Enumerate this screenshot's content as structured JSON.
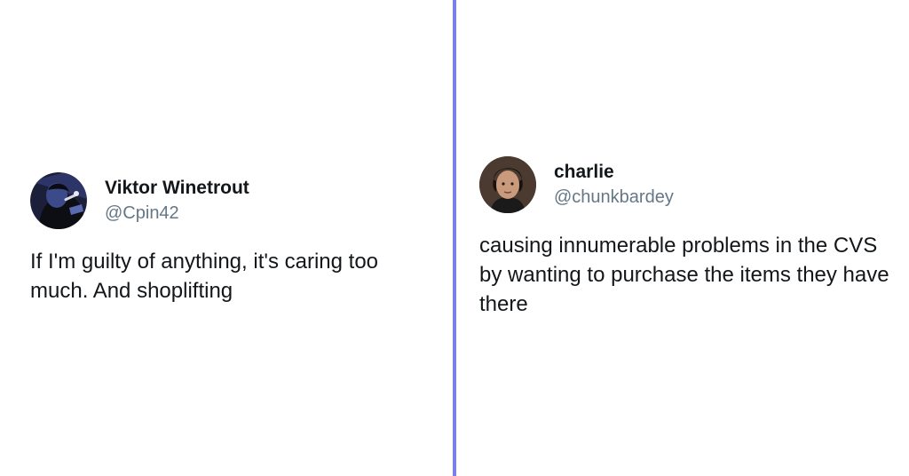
{
  "tweets": [
    {
      "display_name": "Viktor Winetrout",
      "handle": "@Cpin42",
      "text": "If I'm guilty of anything, it's caring too much. And shoplifting",
      "avatar_icon": "dark-illustrated-avatar"
    },
    {
      "display_name": "charlie",
      "handle": "@chunkbardey",
      "text": "causing innumerable problems in the CVS by wanting to purchase the items they have there",
      "avatar_icon": "photo-avatar"
    }
  ],
  "colors": {
    "divider": "#7b7fe6",
    "handle": "#657786",
    "text": "#14171a"
  }
}
